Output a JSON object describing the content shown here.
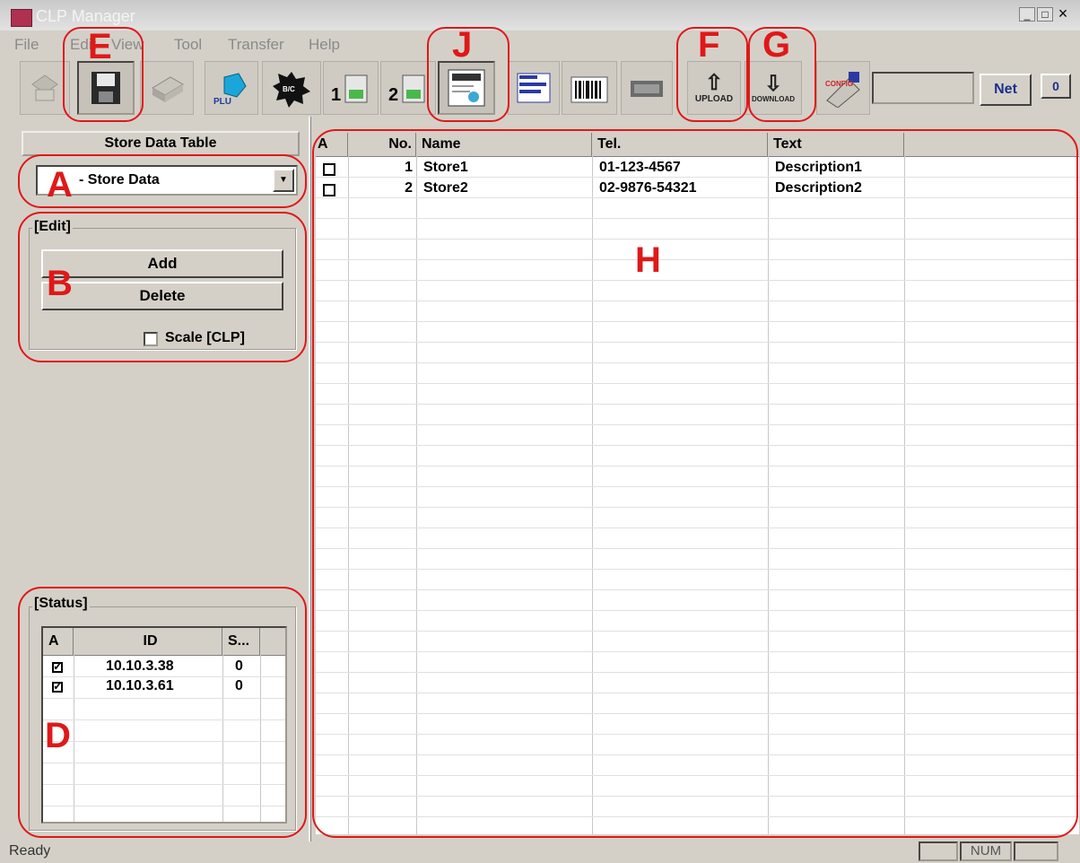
{
  "window": {
    "title": "CLP Manager",
    "minimize": "_",
    "maximize": "□",
    "close": "×"
  },
  "menu": [
    "File",
    "Edit",
    "View",
    "Tool",
    "Transfer",
    "Help"
  ],
  "toolbar": {
    "upload_label": "UPLOAD",
    "download_label": "DOWNLOAD",
    "net_label": "Net",
    "counter": "0",
    "net_field": "",
    "icons": [
      "new-icon",
      "store-data-icon",
      "print-icon",
      "plu-icon",
      "barcode-icon",
      "table1-icon",
      "table2-icon",
      "store-table-icon",
      "preset-icon",
      "label-icon",
      "keyboard-icon",
      "upload-icon",
      "download-icon",
      "config-icon"
    ]
  },
  "left_panel": {
    "title": "Store Data Table",
    "selector_value": "- Store Data",
    "edit_group": {
      "label": "[Edit]",
      "add": "Add",
      "delete": "Delete",
      "scale_checkbox": "Scale [CLP]"
    },
    "status_group": {
      "label": "[Status]",
      "columns": [
        "A",
        "ID",
        "S..."
      ],
      "rows": [
        {
          "checked": true,
          "id": "10.10.3.38",
          "s": "0"
        },
        {
          "checked": true,
          "id": "10.10.3.61",
          "s": "0"
        }
      ]
    }
  },
  "store_table": {
    "columns": [
      "A",
      "No.",
      "Name",
      "Tel.",
      "Text"
    ],
    "rows": [
      {
        "checked": false,
        "no": "1",
        "name": "Store1",
        "tel": "01-123-4567",
        "text": "Description1"
      },
      {
        "checked": false,
        "no": "2",
        "name": "Store2",
        "tel": "02-9876-54321",
        "text": "Description2"
      }
    ]
  },
  "statusbar": {
    "text": "Ready",
    "num": "NUM"
  },
  "callouts": {
    "a": "A",
    "b": "B",
    "d": "D",
    "e": "E",
    "f": "F",
    "g": "G",
    "h": "H",
    "j": "J"
  },
  "colors": {
    "callout": "#e01818",
    "face": "#d4d0c8"
  }
}
